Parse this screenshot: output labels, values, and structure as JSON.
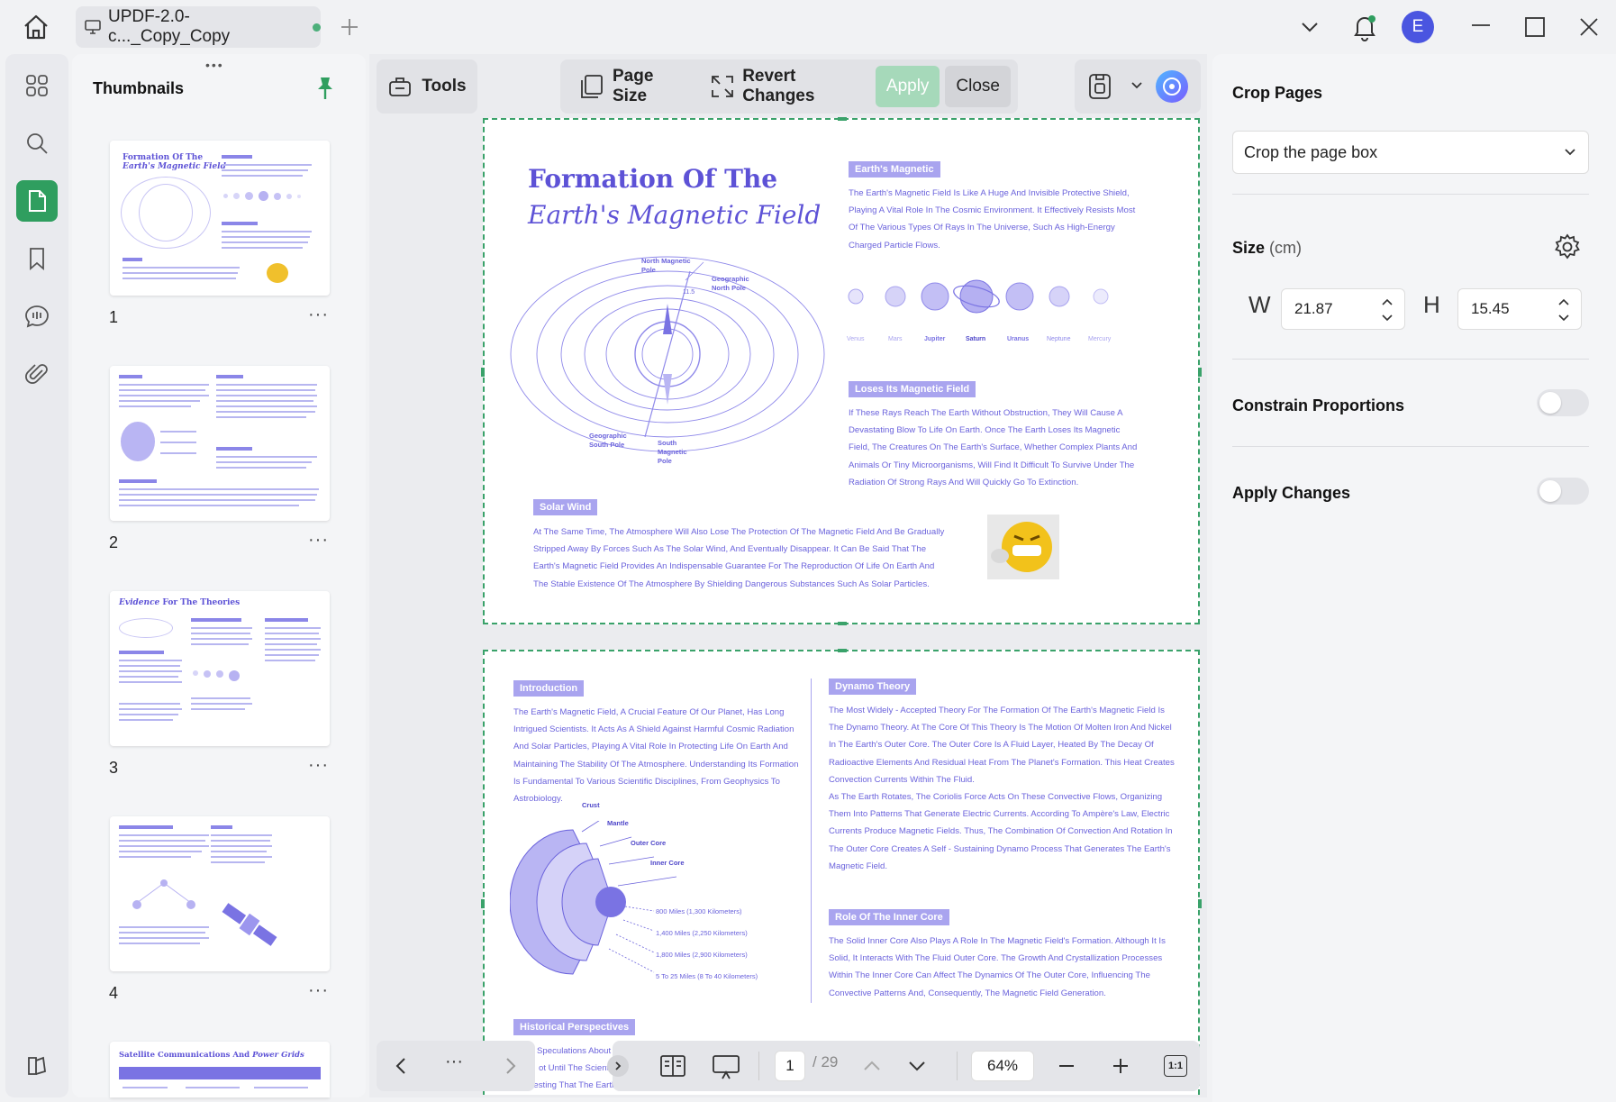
{
  "titlebar": {
    "tab_title": "UPDF-2.0-c..._Copy_Copy",
    "avatar_initial": "E",
    "accent": "#2f9e5f"
  },
  "thumbnails": {
    "title": "Thumbnails",
    "pages": [
      {
        "num": "1",
        "more": "···"
      },
      {
        "num": "2",
        "more": "···"
      },
      {
        "num": "3",
        "more": "···"
      },
      {
        "num": "4",
        "more": "···"
      }
    ],
    "page3_heading_a": "Evidence",
    "page3_heading_b": "For The Theories",
    "page5_heading_a": "Satellite Communications And",
    "page5_heading_b": "Power Grids"
  },
  "toolbar": {
    "tools": "Tools",
    "page_size": "Page Size",
    "revert": "Revert Changes",
    "apply": "Apply",
    "close": "Close"
  },
  "doc": {
    "p1": {
      "title1": "Formation Of The",
      "title2": "Earth's Magnetic Field",
      "badge_magnetic": "Earth's Magnetic",
      "text_magnetic": [
        "The Earth's Magnetic Field Is Like A Huge And Invisible Protective Shield,",
        "Playing A Vital Role In The Cosmic Environment. It Effectively Resists Most",
        "Of The Various Types Of Rays In The Universe, Such As High-Energy",
        "Charged Particle Flows."
      ],
      "planets": [
        "Venus",
        "Mars",
        "Jupiter",
        "Saturn",
        "Uranus",
        "Neptune",
        "Mercury"
      ],
      "badge_loses": "Loses Its Magnetic Field",
      "text_loses": [
        "If These Rays Reach The Earth Without Obstruction, They Will Cause A",
        "Devastating Blow To Life On Earth. Once The Earth Loses Its Magnetic",
        "Field, The Creatures On The Earth's Surface, Whether Complex Plants And",
        "Animals Or Tiny Microorganisms, Will Find It Difficult To Survive Under The",
        "Radiation Of Strong Rays And Will Quickly Go To Extinction."
      ],
      "badge_solar": "Solar Wind",
      "text_solar": [
        "At The Same Time, The Atmosphere Will Also Lose The Protection Of The Magnetic Field And Be Gradually",
        "Stripped Away By Forces Such As The Solar Wind, And Eventually Disappear. It Can Be Said That The",
        "Earth's Magnetic Field Provides An Indispensable Guarantee For The Reproduction Of Life On Earth And",
        "The Stable Existence Of The Atmosphere By Shielding Dangerous Substances Such As Solar Particles."
      ],
      "diagram_labels": {
        "north_magnetic": "North Magnetic Pole",
        "geo_north": "Geographic North Pole",
        "geo_south": "Geographic South Pole",
        "south_magnetic": "South Magnetic Pole",
        "angle": "11.5"
      }
    },
    "p2": {
      "badge_intro": "Introduction",
      "text_intro": [
        "The Earth's Magnetic Field, A Crucial Feature Of Our Planet, Has Long",
        "Intrigued Scientists. It Acts As A Shield Against Harmful Cosmic Radiation",
        "And Solar Particles, Playing A Vital Role In Protecting Life On Earth And",
        "Maintaining The Stability Of The Atmosphere. Understanding Its Formation",
        "Is Fundamental To Various Scientific Disciplines, From Geophysics To",
        "Astrobiology."
      ],
      "badge_dynamo": "Dynamo Theory",
      "text_dynamo": [
        "The Most Widely - Accepted Theory For The Formation Of The Earth's Magnetic Field Is",
        "The Dynamo Theory. At The Core Of This Theory Is The Motion Of Molten Iron And Nickel",
        "In The Earth's Outer Core. The Outer Core Is A Fluid Layer, Heated By The Decay Of",
        "Radioactive Elements And Residual Heat From The Planet's Formation. This Heat Creates",
        "Convection Currents Within The Fluid.",
        "As The Earth Rotates, The Coriolis Force Acts On These Convective Flows, Organizing",
        "Them Into Patterns That Generate Electric Currents. According To Ampère's Law, Electric",
        "Currents Produce Magnetic Fields. Thus, The Combination Of Convection And Rotation In",
        "The Outer Core Creates A Self - Sustaining Dynamo Process That Generates The Earth's",
        "Magnetic Field."
      ],
      "layers": [
        "Crust",
        "Mantle",
        "Outer Core",
        "Inner Core"
      ],
      "depths": [
        "800 Miles (1,300 Kilometers)",
        "1,400 Miles (2,250 Kilometers)",
        "1,800 Miles (2,900 Kilometers)",
        "5 To 25 Miles (8 To 40 Kilometers)"
      ],
      "badge_inner": "Role Of The Inner Core",
      "text_inner": [
        "The Solid Inner Core Also Plays A Role In The Magnetic Field's Formation. Although It Is",
        "Solid, It Interacts With The Fluid Outer Core. The Growth And Crystallization Processes",
        "Within The Inner Core Can Affect The Dynamics Of The Outer Core, Influencing The",
        "Convective Patterns And, Consequently, The Magnetic Field Generation."
      ],
      "badge_hist": "Historical Perspectives",
      "text_hist_1": "Speculations About",
      "text_hist_2": "ot Until The Scient",
      "text_hist_3": "Suggesting That The Earth Was A Giant Magnet. Over Time, With The Development Of More Advanced Instruments And Theories, Our Understanding Of The Magnetic"
    }
  },
  "bottombar": {
    "more": "···",
    "page_current": "1",
    "page_total": "/ 29",
    "zoom": "64%",
    "fit": "1:1"
  },
  "rightpanel": {
    "title": "Crop Pages",
    "select_value": "Crop the page box",
    "size_label": "Size",
    "size_unit": "(cm)",
    "w_label": "W",
    "w_value": "21.87",
    "h_label": "H",
    "h_value": "15.45",
    "constrain": "Constrain Proportions",
    "apply_changes": "Apply Changes"
  }
}
